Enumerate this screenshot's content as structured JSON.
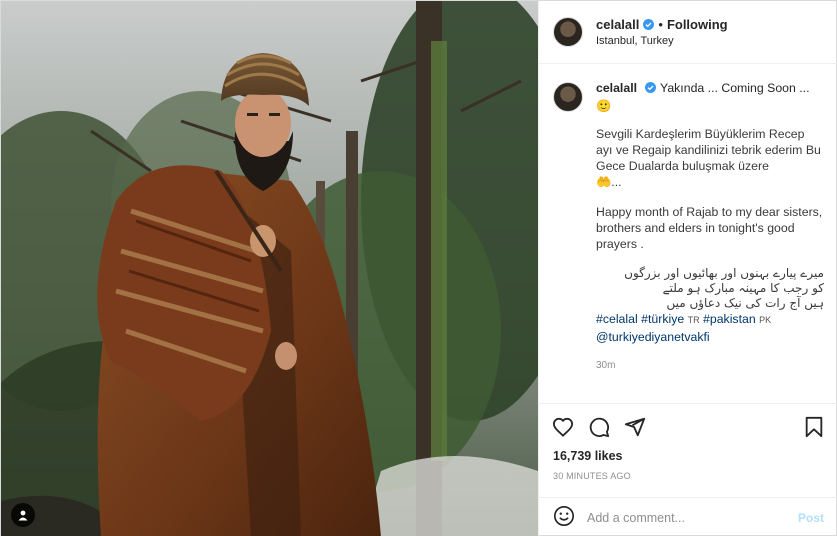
{
  "post": {
    "username": "celalall",
    "following_label": "Following",
    "location": "Istanbul, Turkey",
    "caption": {
      "username": "celalall",
      "line1": "Yakında ... Coming Soon ...",
      "emoji1": "🙂",
      "turkish": "Sevgili Kardeşlerim Büyüklerim Recep ayı ve Regaip kandilinizi tebrik ederim Bu Gece Dualarda buluşmak üzere",
      "emoji2": "🤲...",
      "english": "Happy month of Rajab to my dear sisters, brothers and elders in tonight's good prayers .",
      "urdu_line1": "میرے پیارے بہنوں اور بھائیوں اور بزرگوں",
      "urdu_line2": "کو رجب کا مہینہ مبارک ہو ملتے",
      "urdu_line3": "ہیں آج رات کی نیک دعاؤں میں",
      "hashtag1": "#celalal",
      "hashtag2": "#türkiye",
      "cc1": "TR",
      "hashtag3": "#pakistan",
      "cc2": "PK",
      "mention": "@turkiyediyanetvakfi",
      "time": "30m"
    },
    "likes": "16,739 likes",
    "posted_ago": "30 MINUTES AGO",
    "comment_placeholder": "Add a comment...",
    "post_button": "Post"
  },
  "icons": {
    "like": "heart-icon",
    "comment": "comment-bubble-icon",
    "share": "paper-plane-icon",
    "save": "bookmark-icon",
    "emoji": "smiley-icon",
    "verified": "verified-badge-icon",
    "tag": "person-tag-icon"
  },
  "colors": {
    "link": "#00376b",
    "verified": "#3897f0",
    "post_button_disabled": "#b2dffc",
    "muted": "#8e8e8e",
    "border": "#dbdbdb"
  }
}
